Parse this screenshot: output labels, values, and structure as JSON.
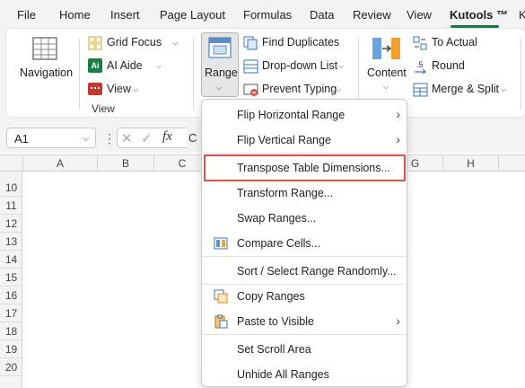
{
  "tabs": [
    "File",
    "Home",
    "Insert",
    "Page Layout",
    "Formulas",
    "Data",
    "Review",
    "View",
    "Kutools ™",
    "K"
  ],
  "active_tab": "Kutools ™",
  "ribbon": {
    "navigation": "Navigation",
    "grid_focus": "Grid Focus",
    "ai_aide": "AI Aide",
    "view": "View",
    "group_view_label": "View",
    "range": "Range",
    "find_duplicates": "Find Duplicates",
    "dropdown_list": "Drop-down List",
    "prevent_typing": "Prevent Typing",
    "content": "Content",
    "to_actual": "To Actual",
    "round": "Round",
    "merge_split": "Merge & Split"
  },
  "formula_bar": {
    "name_box": "A1",
    "fx": "fx",
    "partial_text": "C"
  },
  "columns": [
    "A",
    "B",
    "C",
    "G",
    "H"
  ],
  "rows": [
    "10",
    "11",
    "12",
    "13",
    "14",
    "15",
    "16",
    "17",
    "18",
    "19",
    "20"
  ],
  "menu": {
    "items": [
      {
        "label": "Flip Horizontal Range",
        "arrow": true
      },
      {
        "label": "Flip Vertical Range",
        "arrow": true
      },
      {
        "label": "Transpose Table Dimensions...",
        "highlighted": true
      },
      {
        "label": "Transform Range..."
      },
      {
        "label": "Swap Ranges..."
      },
      {
        "label": "Compare Cells...",
        "icon": "compare-cells-icon"
      },
      {
        "label": "Sort / Select Range Randomly..."
      },
      {
        "label": "Copy Ranges",
        "icon": "copy-ranges-icon"
      },
      {
        "label": "Paste to Visible",
        "icon": "paste-visible-icon",
        "arrow": true
      },
      {
        "label": "Set Scroll Area"
      },
      {
        "label": "Unhide All Ranges"
      }
    ]
  },
  "colors": {
    "excel_green": "#217346",
    "highlight_border": "#d9534f"
  }
}
